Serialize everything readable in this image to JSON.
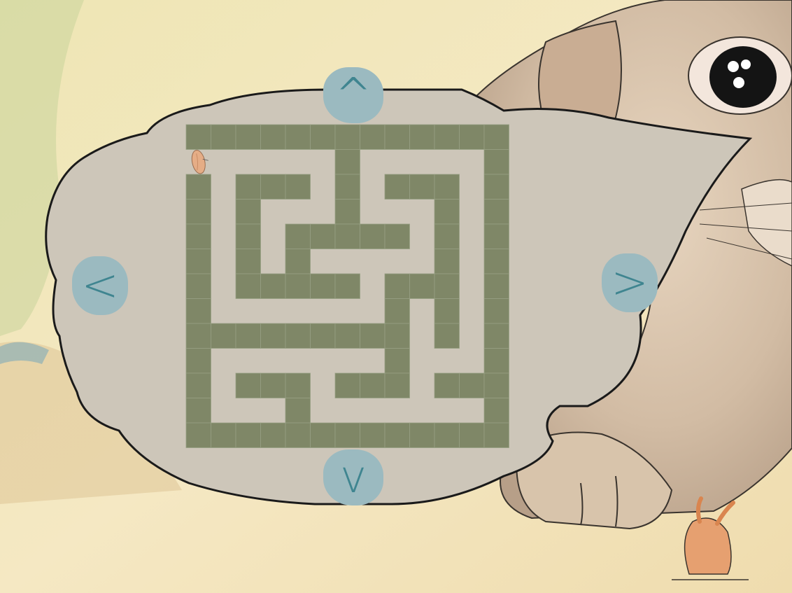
{
  "controls": {
    "up_label": "^",
    "down_label": "v",
    "left_label": "<",
    "right_label": ">"
  },
  "colors": {
    "wall": "#7f8767",
    "path": "#cdc6b9",
    "bubble": "#cdc6b9",
    "button": "#9bbac0",
    "button_glyph": "#3f8590"
  },
  "player": {
    "icon": "seed-icon",
    "row": 1,
    "col": 0
  },
  "maze": {
    "rows": 13,
    "cols": 13,
    "grid": [
      "#############",
      "......#.....#",
      "#.###.#.###.#",
      "#.#...#...#.#",
      "#.#.#####.#.#",
      "#.#.#.....#.#",
      "#.#####.###.#",
      "#.......#.#.#",
      "#########.#.#",
      "#.......#...#",
      "#.###.###.###",
      "#...#.......#",
      "#############"
    ]
  }
}
